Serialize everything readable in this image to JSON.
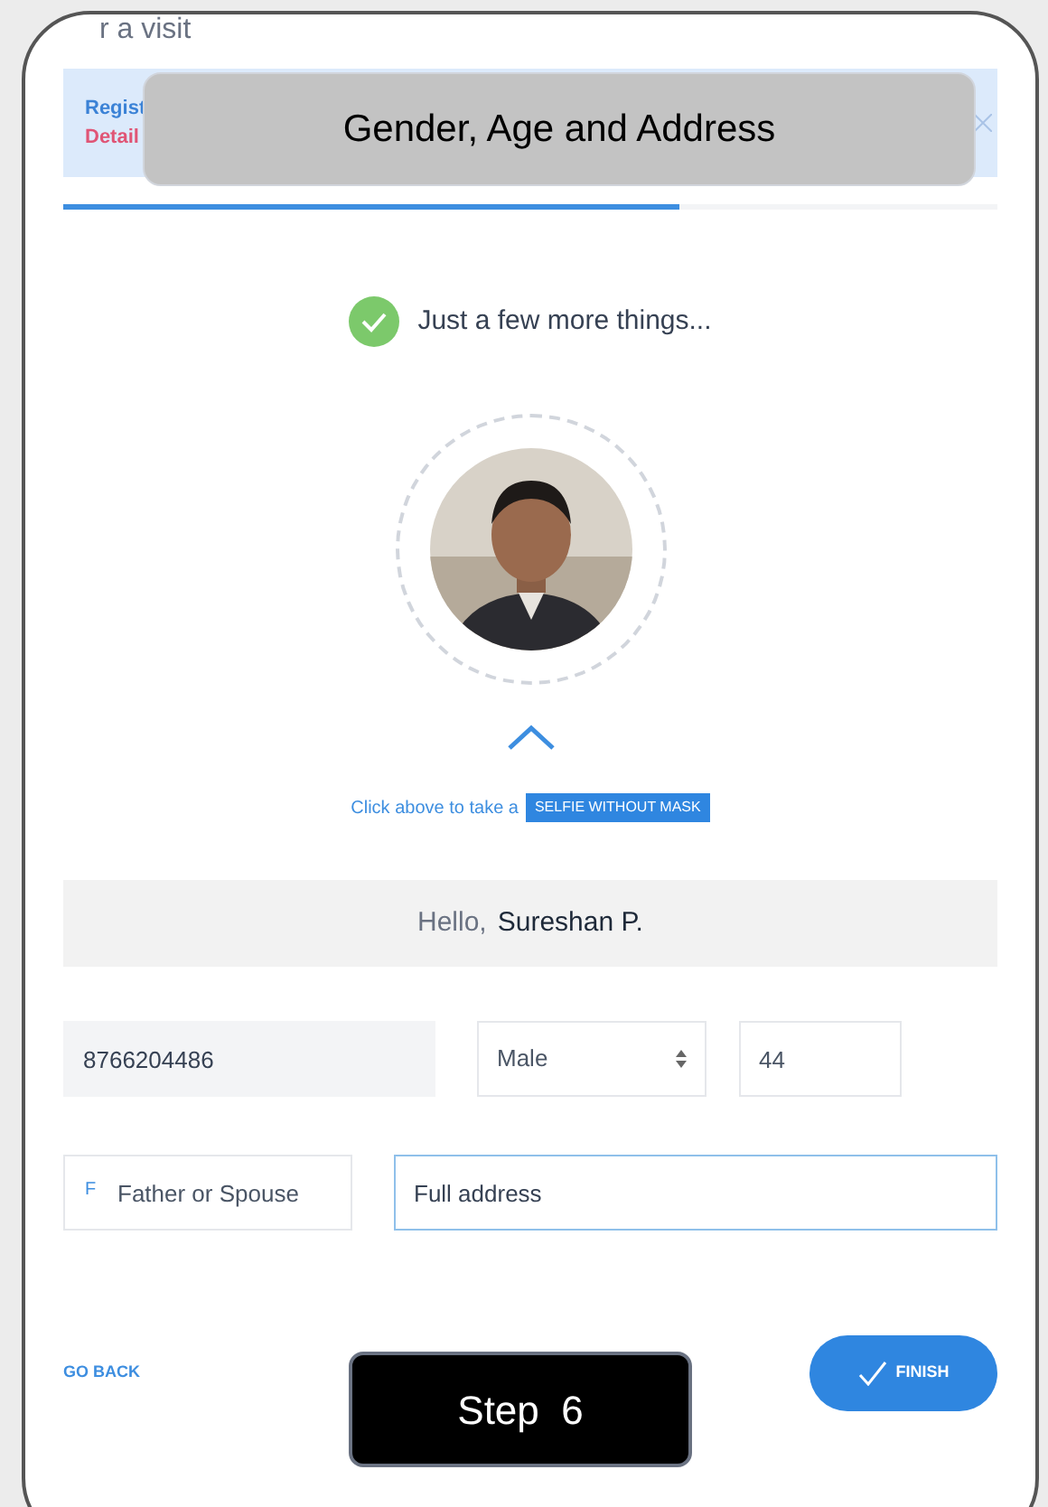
{
  "header": {
    "title": "r a visit"
  },
  "banner": {
    "line_1": "Regist",
    "line_2": "Detail"
  },
  "caption": "Gender, Age and Address",
  "progress": {
    "level": 0.66
  },
  "status": {
    "text": "Just a few more things..."
  },
  "selfie_hint": {
    "text": "Click above to take a",
    "badge": "SELFIE WITHOUT MASK"
  },
  "greeting": {
    "hello": "Hello,",
    "name": "Sureshan P."
  },
  "fields": [
    {
      "kind": "text",
      "value": "8766204486",
      "disabled": true
    },
    {
      "kind": "select",
      "value": "Male"
    },
    {
      "kind": "text",
      "value": "44",
      "disabled": false
    }
  ],
  "relation_field": {
    "prefix": "F",
    "placeholder": "Father or Spouse"
  },
  "address_field": {
    "value": "Full address",
    "focused": true
  },
  "footer": {
    "back": "GO BACK",
    "finish": "FINISH"
  },
  "step_caption": "Step  6"
}
